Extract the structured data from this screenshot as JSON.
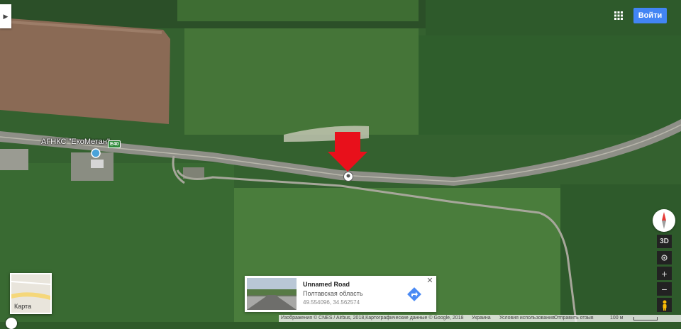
{
  "header": {
    "signin_label": "Войти",
    "collapse_icon": "chevron-right-icon",
    "apps_icon": "apps-grid-icon"
  },
  "map": {
    "place_label": "АГНКС \"ЕкоМетан\"",
    "road_number": "E40",
    "selected_pin_icon": "place-marker-icon",
    "annotation_arrow_color": "#e8101b"
  },
  "layer_switcher": {
    "label": "Карта"
  },
  "info_card": {
    "title": "Unnamed Road",
    "region": "Полтавская область",
    "coords": "49.554096, 34.562574",
    "close_label": "✕",
    "directions_icon": "directions-icon"
  },
  "controls": {
    "label_3d": "3D",
    "zoom_in": "+",
    "zoom_out": "−",
    "compass_icon": "compass-icon",
    "my_location_icon": "my-location-icon",
    "pegman_icon": "pegman-icon"
  },
  "footer": {
    "imagery": "Изображения © CNES / Airbus, 2018,Картографические данные © Google, 2018",
    "country": "Украина",
    "terms": "Условия использования",
    "feedback": "Отправить отзыв",
    "scale": "100 м"
  }
}
